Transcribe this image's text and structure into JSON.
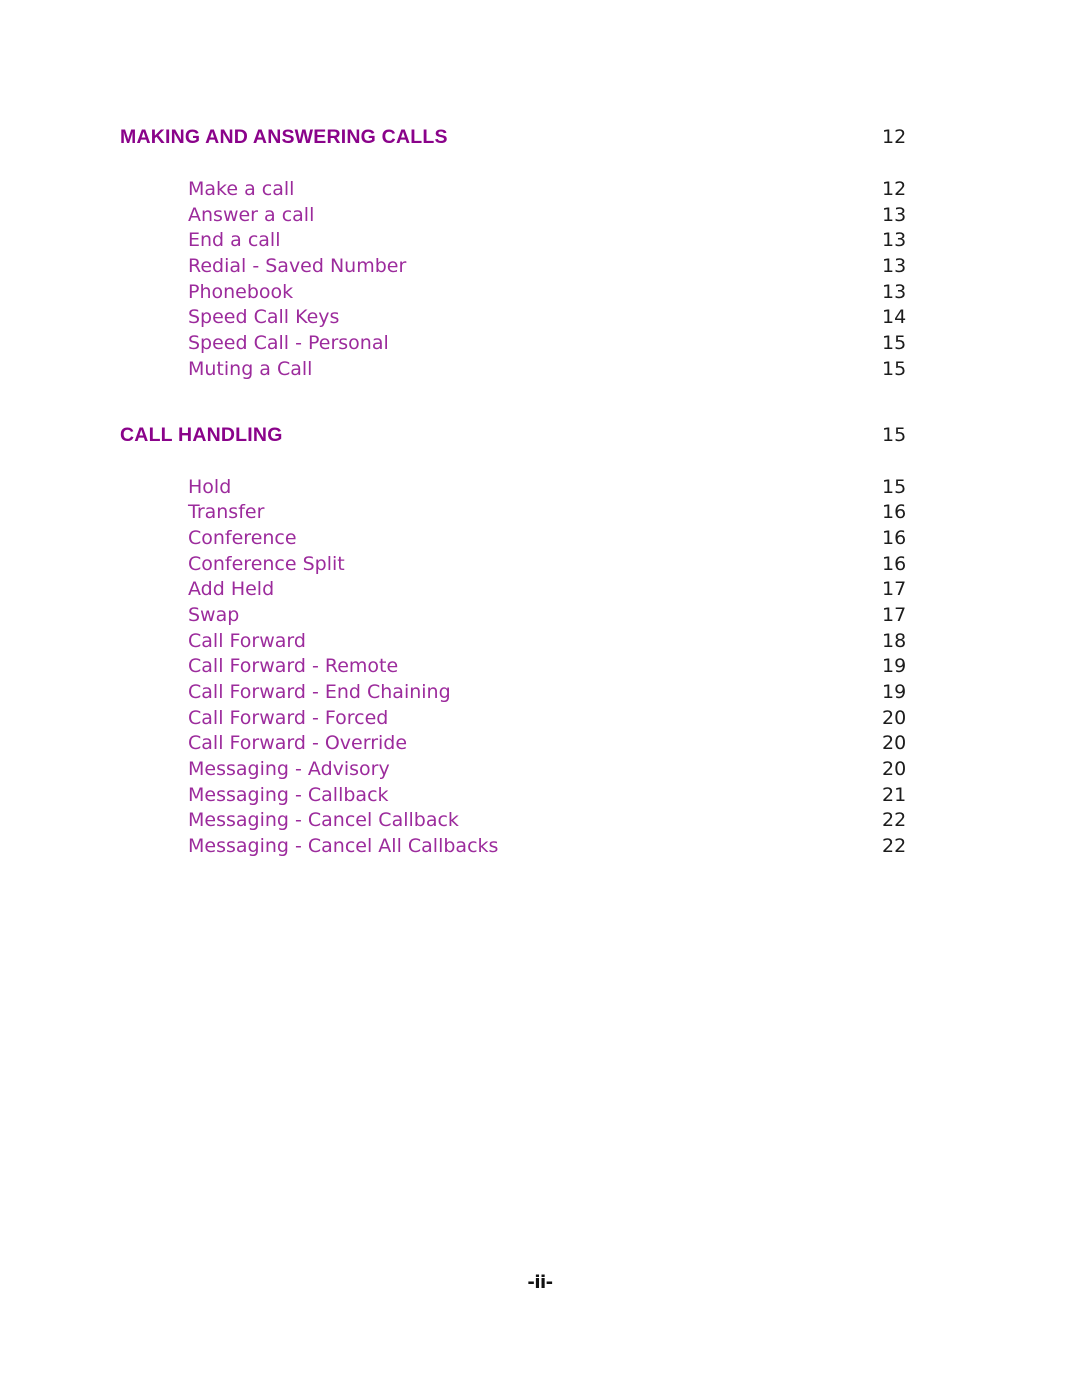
{
  "document": {
    "type": "table-of-contents",
    "footer_label": "-ii-"
  },
  "sections": [
    {
      "heading": "MAKING AND ANSWERING CALLS",
      "page": "12",
      "entries": [
        {
          "label": "Make a call",
          "page": "12"
        },
        {
          "label": "Answer a call",
          "page": "13"
        },
        {
          "label": "End a call",
          "page": "13"
        },
        {
          "label": "Redial - Saved Number",
          "page": "13"
        },
        {
          "label": "Phonebook",
          "page": "13"
        },
        {
          "label": "Speed Call Keys",
          "page": "14"
        },
        {
          "label": "Speed Call - Personal",
          "page": "15"
        },
        {
          "label": "Muting a Call",
          "page": "15"
        }
      ]
    },
    {
      "heading": "CALL HANDLING",
      "page": "15",
      "entries": [
        {
          "label": "Hold",
          "page": "15"
        },
        {
          "label": "Transfer",
          "page": "16"
        },
        {
          "label": "Conference",
          "page": "16"
        },
        {
          "label": "Conference Split",
          "page": "16"
        },
        {
          "label": "Add Held",
          "page": "17"
        },
        {
          "label": "Swap",
          "page": "17"
        },
        {
          "label": "Call Forward",
          "page": "18"
        },
        {
          "label": "Call Forward - Remote",
          "page": "19"
        },
        {
          "label": "Call Forward - End Chaining",
          "page": "19"
        },
        {
          "label": "Call Forward - Forced",
          "page": "20"
        },
        {
          "label": "Call Forward - Override",
          "page": "20"
        },
        {
          "label": "Messaging - Advisory",
          "page": "20"
        },
        {
          "label": "Messaging - Callback",
          "page": "21"
        },
        {
          "label": "Messaging - Cancel Callback",
          "page": "22"
        },
        {
          "label": "Messaging - Cancel All Callbacks",
          "page": "22"
        }
      ]
    }
  ],
  "colors": {
    "heading": "#8a038a",
    "entry": "#9c2b9c",
    "page_number": "#1c1c1c",
    "background": "#ffffff"
  }
}
